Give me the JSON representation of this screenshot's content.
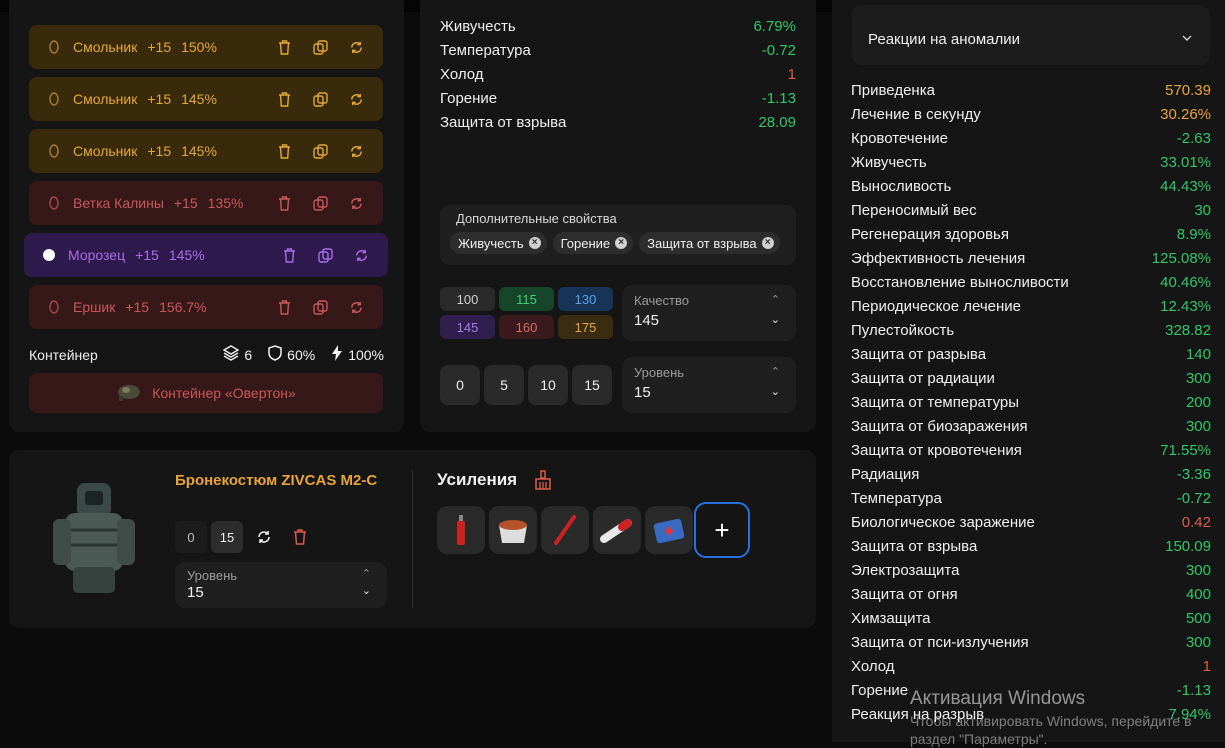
{
  "artifacts": [
    {
      "name": "Смольник",
      "level": "+15",
      "percent": "150%",
      "color": "gold"
    },
    {
      "name": "Смольник",
      "level": "+15",
      "percent": "145%",
      "color": "gold"
    },
    {
      "name": "Смольник",
      "level": "+15",
      "percent": "145%",
      "color": "gold"
    },
    {
      "name": "Ветка Калины",
      "level": "+15",
      "percent": "135%",
      "color": "red"
    },
    {
      "name": "Морозец",
      "level": "+15",
      "percent": "145%",
      "color": "purple"
    },
    {
      "name": "Ершик",
      "level": "+15",
      "percent": "156.7%",
      "color": "red"
    }
  ],
  "container": {
    "label": "Контейнер",
    "slots": "6",
    "protection": "60%",
    "efficiency": "100%",
    "button": "Контейнер «Овертон»"
  },
  "mid_stats": [
    {
      "name": "Живучесть",
      "value": "6.79%",
      "tone": "pos"
    },
    {
      "name": "Температура",
      "value": "-0.72",
      "tone": "pos"
    },
    {
      "name": "Холод",
      "value": "1",
      "tone": "warn"
    },
    {
      "name": "Горение",
      "value": "-1.13",
      "tone": "pos"
    },
    {
      "name": "Защита от взрыва",
      "value": "28.09",
      "tone": "pos"
    }
  ],
  "extra": {
    "title": "Дополнительные свойства",
    "chips": [
      "Живучесть",
      "Горение",
      "Защита от взрыва"
    ]
  },
  "quality_options": [
    {
      "v": "100",
      "bg": "#2a2a2a",
      "fg": "#d0d0d0"
    },
    {
      "v": "115",
      "bg": "#16452a",
      "fg": "#3fd07a"
    },
    {
      "v": "130",
      "bg": "#173456",
      "fg": "#5aa0ea"
    },
    {
      "v": "145",
      "bg": "#2f1e4e",
      "fg": "#a97be6"
    },
    {
      "v": "160",
      "bg": "#3a1a1c",
      "fg": "#d46a6a"
    },
    {
      "v": "175",
      "bg": "#3a2c10",
      "fg": "#e6a93b"
    }
  ],
  "quality": {
    "label": "Качество",
    "value": "145"
  },
  "level_buttons": [
    "0",
    "5",
    "10",
    "15"
  ],
  "level": {
    "label": "Уровень",
    "value": "15"
  },
  "reactions_dropdown": "Реакции на аномалии",
  "right_stats": [
    {
      "name": "Приведенка",
      "value": "570.39",
      "tone": "gold"
    },
    {
      "name": "Лечение в секунду",
      "value": "30.26%",
      "tone": "gold"
    },
    {
      "name": "Кровотечение",
      "value": "-2.63",
      "tone": "pos"
    },
    {
      "name": "Живучесть",
      "value": "33.01%",
      "tone": "pos"
    },
    {
      "name": "Выносливость",
      "value": "44.43%",
      "tone": "pos"
    },
    {
      "name": "Переносимый вес",
      "value": "30",
      "tone": "pos"
    },
    {
      "name": "Регенерация здоровья",
      "value": "8.9%",
      "tone": "pos"
    },
    {
      "name": "Эффективность лечения",
      "value": "125.08%",
      "tone": "pos"
    },
    {
      "name": "Восстановление выносливости",
      "value": "40.46%",
      "tone": "pos"
    },
    {
      "name": "Периодическое лечение",
      "value": "12.43%",
      "tone": "pos"
    },
    {
      "name": "Пулестойкость",
      "value": "328.82",
      "tone": "pos"
    },
    {
      "name": "Защита от разрыва",
      "value": "140",
      "tone": "pos"
    },
    {
      "name": "Защита от радиации",
      "value": "300",
      "tone": "pos"
    },
    {
      "name": "Защита от температуры",
      "value": "200",
      "tone": "pos"
    },
    {
      "name": "Защита от биозаражения",
      "value": "300",
      "tone": "pos"
    },
    {
      "name": "Защита от кровотечения",
      "value": "71.55%",
      "tone": "pos"
    },
    {
      "name": "Радиация",
      "value": "-3.36",
      "tone": "pos"
    },
    {
      "name": "Температура",
      "value": "-0.72",
      "tone": "pos"
    },
    {
      "name": "Биологическое заражение",
      "value": "0.42",
      "tone": "warn"
    },
    {
      "name": "Защита от взрыва",
      "value": "150.09",
      "tone": "pos"
    },
    {
      "name": "Электрозащита",
      "value": "300",
      "tone": "pos"
    },
    {
      "name": "Защита от огня",
      "value": "400",
      "tone": "pos"
    },
    {
      "name": "Химзащита",
      "value": "500",
      "tone": "pos"
    },
    {
      "name": "Защита от пси-излучения",
      "value": "300",
      "tone": "pos"
    },
    {
      "name": "Холод",
      "value": "1",
      "tone": "warn"
    },
    {
      "name": "Горение",
      "value": "-1.13",
      "tone": "pos"
    },
    {
      "name": "Реакция на разрыв",
      "value": "7.94%",
      "tone": "pos"
    }
  ],
  "armor": {
    "name": "Бронекостюм ZIVCAS M2-C",
    "btn_min": "0",
    "btn_max": "15",
    "level_label": "Уровень",
    "level_value": "15"
  },
  "boosts": {
    "title": "Усиления",
    "add": "+"
  },
  "watermark": {
    "title": "Активация Windows",
    "sub": "Чтобы активировать Windows, перейдите в раздел \"Параметры\"."
  }
}
